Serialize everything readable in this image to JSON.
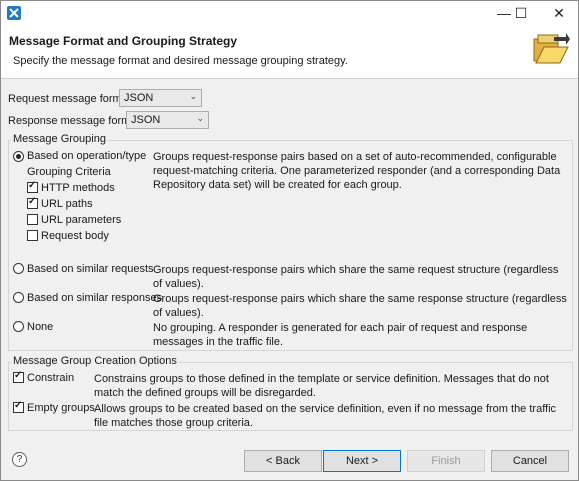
{
  "window": {
    "minimize_glyph": "—",
    "maximize_glyph": "☐",
    "close_glyph": "✕"
  },
  "header": {
    "title": "Message Format and Grouping Strategy",
    "description": "Specify the message format and desired message grouping strategy."
  },
  "formats": {
    "request_label": "Request message format:",
    "request_value": "JSON",
    "response_label": "Response message format:",
    "response_value": "JSON"
  },
  "grouping": {
    "title": "Message Grouping",
    "operation": {
      "label": "Based on operation/type",
      "description": "Groups request-response pairs based on a set of auto-recommended, configurable request-matching criteria. One parameterized responder (and a corresponding Data Repository data set) will be created for each group.",
      "criteria_label": "Grouping Criteria",
      "criteria": [
        {
          "label": "HTTP methods",
          "checked": true
        },
        {
          "label": "URL paths",
          "checked": true
        },
        {
          "label": "URL parameters",
          "checked": false
        },
        {
          "label": "Request body",
          "checked": false
        }
      ]
    },
    "similar_requests": {
      "label": "Based on similar requests",
      "description": "Groups request-response pairs which share the same request structure (regardless of values)."
    },
    "similar_responses": {
      "label": "Based on similar responses",
      "description": "Groups request-response pairs which share the same response structure (regardless of values)."
    },
    "none": {
      "label": "None",
      "description": "No grouping. A responder is generated for each pair of request and response messages in the traffic file."
    }
  },
  "creation": {
    "title": "Message Group Creation Options",
    "constrain": {
      "label": "Constrain",
      "description": "Constrains groups to those defined in the template or service definition. Messages that do not match the defined groups will be disregarded."
    },
    "empty_groups": {
      "label": "Empty groups",
      "description": "Allows groups to be created based on the service definition, even if no message from the traffic file matches those group criteria."
    }
  },
  "buttons": {
    "help": "?",
    "back": "< Back",
    "next": "Next >",
    "finish": "Finish",
    "cancel": "Cancel"
  }
}
